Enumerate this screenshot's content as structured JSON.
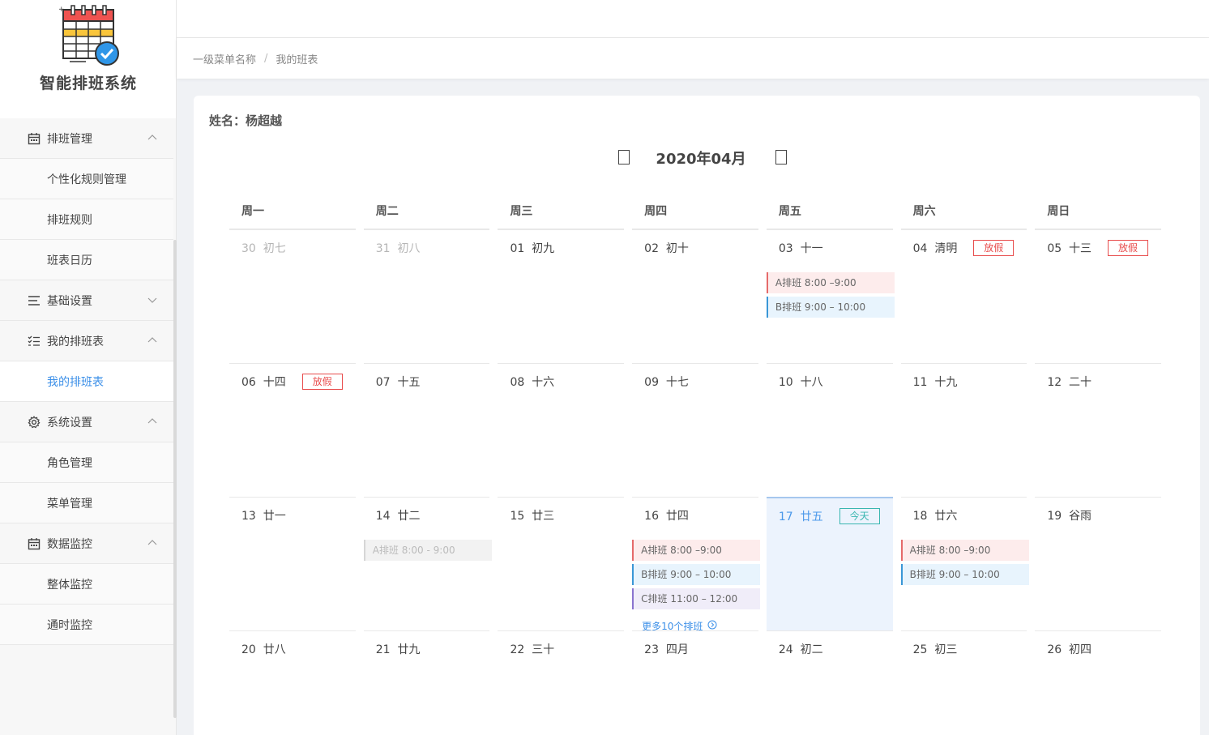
{
  "app": {
    "title": "智能排班系统"
  },
  "sidebar": {
    "items": [
      {
        "type": "group",
        "label": "排班管理",
        "icon": "calendar-icon",
        "chevron": "up"
      },
      {
        "type": "sub",
        "label": "个性化规则管理"
      },
      {
        "type": "sub",
        "label": "排班规则"
      },
      {
        "type": "sub",
        "label": "班表日历"
      },
      {
        "type": "group",
        "label": "基础设置",
        "icon": "menu-lines-icon",
        "chevron": "down"
      },
      {
        "type": "group",
        "label": "我的排班表",
        "icon": "checklist-icon",
        "chevron": "up"
      },
      {
        "type": "sub",
        "label": "我的排班表",
        "active": true
      },
      {
        "type": "group",
        "label": "系统设置",
        "icon": "gear-icon",
        "chevron": "up"
      },
      {
        "type": "sub",
        "label": "角色管理"
      },
      {
        "type": "sub",
        "label": "菜单管理"
      },
      {
        "type": "group",
        "label": "数据监控",
        "icon": "calendar-icon",
        "chevron": "up"
      },
      {
        "type": "sub",
        "label": "整体监控"
      },
      {
        "type": "sub",
        "label": "通时监控"
      }
    ]
  },
  "breadcrumb": {
    "level1": "一级菜单名称",
    "sep": "/",
    "current": "我的班表"
  },
  "main": {
    "name_line": "姓名：杨超越",
    "month_title": "2020年04月"
  },
  "calendar": {
    "weekdays": [
      "周一",
      "周二",
      "周三",
      "周四",
      "周五",
      "周六",
      "周日"
    ],
    "more_label": "更多10个排班",
    "rows": [
      [
        {
          "day": "30",
          "lunar": "初七",
          "dim": true
        },
        {
          "day": "31",
          "lunar": "初八",
          "dim": true
        },
        {
          "day": "01",
          "lunar": "初九"
        },
        {
          "day": "02",
          "lunar": "初十"
        },
        {
          "day": "03",
          "lunar": "十一",
          "shifts": [
            {
              "kind": "a",
              "text": "A排班 8:00 –9:00"
            },
            {
              "kind": "b",
              "text": "B排班 9:00 – 10:00"
            }
          ]
        },
        {
          "day": "04",
          "lunar": "清明",
          "badge": "放假"
        },
        {
          "day": "05",
          "lunar": "十三",
          "badge": "放假"
        }
      ],
      [
        {
          "day": "06",
          "lunar": "十四",
          "badge": "放假"
        },
        {
          "day": "07",
          "lunar": "十五"
        },
        {
          "day": "08",
          "lunar": "十六"
        },
        {
          "day": "09",
          "lunar": "十七"
        },
        {
          "day": "10",
          "lunar": "十八"
        },
        {
          "day": "11",
          "lunar": "十九"
        },
        {
          "day": "12",
          "lunar": "二十"
        }
      ],
      [
        {
          "day": "13",
          "lunar": "廿一"
        },
        {
          "day": "14",
          "lunar": "廿二",
          "shifts": [
            {
              "kind": "g",
              "text": "A排班 8:00 - 9:00"
            }
          ]
        },
        {
          "day": "15",
          "lunar": "廿三"
        },
        {
          "day": "16",
          "lunar": "廿四",
          "shifts": [
            {
              "kind": "a",
              "text": "A排班 8:00 –9:00"
            },
            {
              "kind": "b",
              "text": "B排班 9:00 – 10:00"
            },
            {
              "kind": "c",
              "text": "C排班 11:00 – 12:00"
            }
          ],
          "more": true
        },
        {
          "day": "17",
          "lunar": "廿五",
          "today": true,
          "badge": "今天"
        },
        {
          "day": "18",
          "lunar": "廿六",
          "shifts": [
            {
              "kind": "a",
              "text": "A排班 8:00 –9:00"
            },
            {
              "kind": "b",
              "text": "B排班 9:00 – 10:00"
            }
          ]
        },
        {
          "day": "19",
          "lunar": "谷雨"
        }
      ],
      [
        {
          "day": "20",
          "lunar": "廿八"
        },
        {
          "day": "21",
          "lunar": "廿九"
        },
        {
          "day": "22",
          "lunar": "三十"
        },
        {
          "day": "23",
          "lunar": "四月"
        },
        {
          "day": "24",
          "lunar": "初二"
        },
        {
          "day": "25",
          "lunar": "初三"
        },
        {
          "day": "26",
          "lunar": "初四"
        }
      ]
    ]
  }
}
